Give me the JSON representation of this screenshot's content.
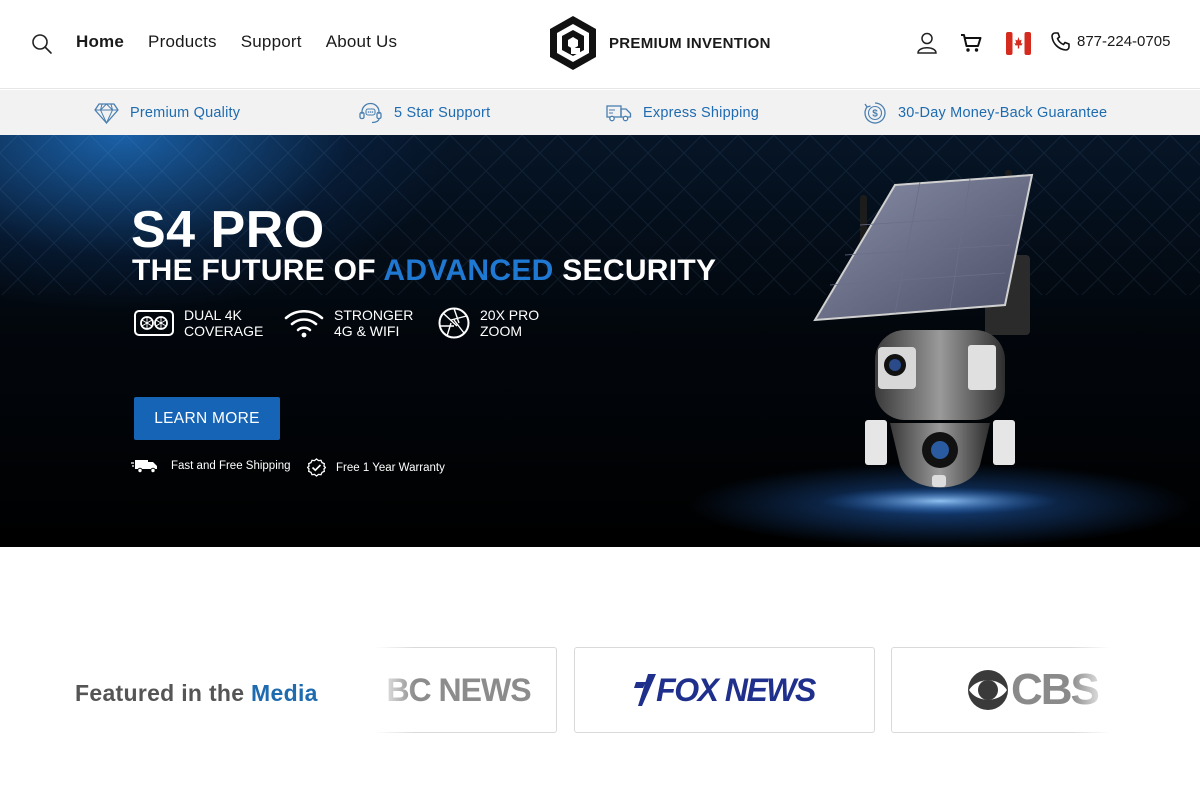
{
  "header": {
    "nav": [
      "Home",
      "Products",
      "Support",
      "About Us"
    ],
    "active_nav": "Home",
    "logo_text": "PREMIUM INVENTION",
    "phone": "877-224-0705",
    "icons": [
      "search-icon",
      "account-icon",
      "cart-icon",
      "canada-flag-icon",
      "phone-icon"
    ]
  },
  "benefits": [
    {
      "label": "Premium Quality",
      "icon": "diamond-icon"
    },
    {
      "label": "5 Star Support",
      "icon": "headset-icon"
    },
    {
      "label": "Express Shipping",
      "icon": "truck-icon"
    },
    {
      "label": "30-Day Money-Back Guarantee",
      "icon": "money-back-icon"
    }
  ],
  "hero": {
    "title": "S4 PRO",
    "subtitle_pre": "THE FUTURE OF ",
    "subtitle_accent": "ADVANCED",
    "subtitle_post": " SECURITY",
    "features": [
      {
        "line1": "DUAL 4K",
        "line2": "COVERAGE",
        "icon": "dual-lens-icon"
      },
      {
        "line1": "STRONGER",
        "line2": "4G & WIFI",
        "icon": "wifi-icon"
      },
      {
        "line1": "20X PRO",
        "line2": "ZOOM",
        "icon": "aperture-icon"
      }
    ],
    "cta": "LEARN MORE",
    "perks": [
      {
        "label": "Fast and Free Shipping",
        "icon": "truck-icon"
      },
      {
        "label": "Free 1 Year Warranty",
        "icon": "check-badge-icon"
      }
    ]
  },
  "media": {
    "title_pre": "Featured in the ",
    "title_accent": "Media",
    "logos": [
      "BC NEWS",
      "FOX NEWS",
      "CBS"
    ]
  },
  "colors": {
    "accent": "#1f78d1",
    "benefit_text": "#1e6bb0",
    "cta_bg": "#1664b6",
    "fox_blue": "#1f2f8c"
  }
}
